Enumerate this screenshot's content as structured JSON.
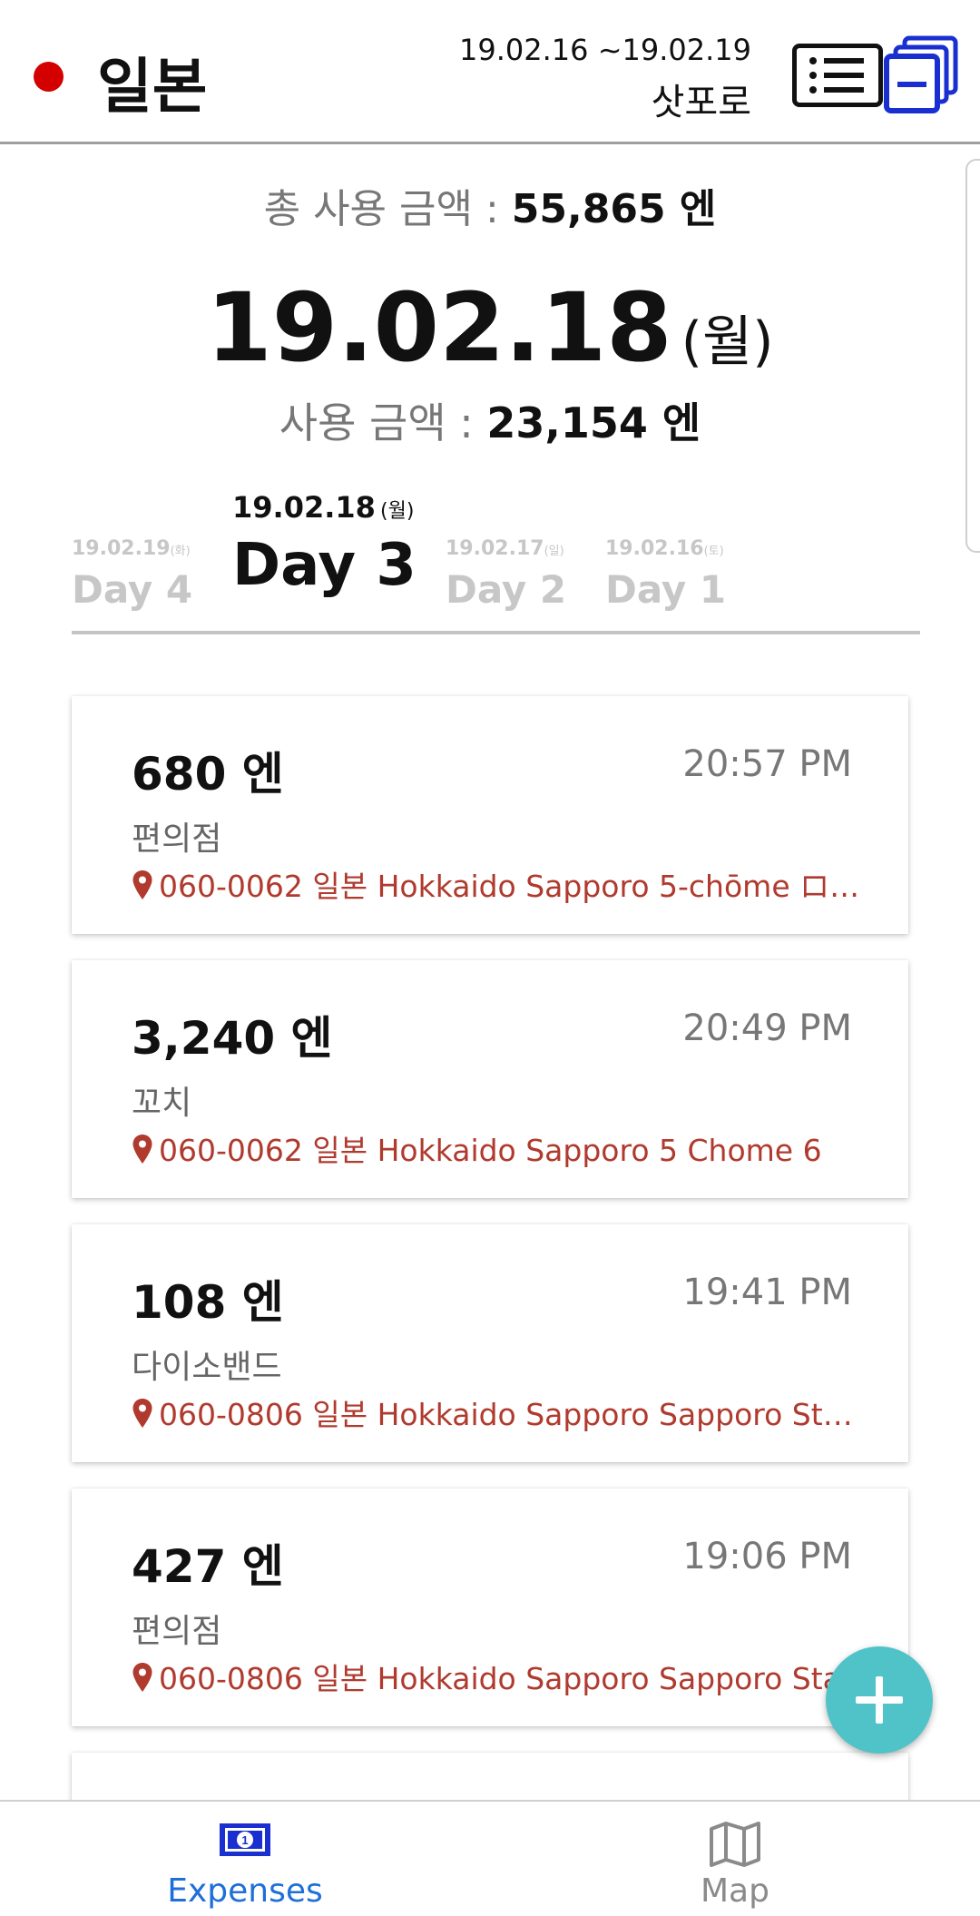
{
  "header": {
    "country": "일본",
    "trip_dates": "19.02.16 ~19.02.19",
    "city": "삿포로",
    "flag_color": "#d40000"
  },
  "summary": {
    "total_label": "총 사용 금액 :",
    "total_value": "55,865 엔",
    "date": "19.02.18",
    "weekday": "(월)",
    "day_label": "사용 금액 :",
    "day_value": "23,154 엔"
  },
  "tabs": [
    {
      "date": "19.02.19",
      "wd": "(화)",
      "label": "Day 4"
    },
    {
      "date": "19.02.18",
      "wd": "(월)",
      "label": "Day 3"
    },
    {
      "date": "19.02.17",
      "wd": "(일)",
      "label": "Day 2"
    },
    {
      "date": "19.02.16",
      "wd": "(토)",
      "label": "Day 1"
    }
  ],
  "expenses": [
    {
      "amount": "680 엔",
      "time": "20:57 PM",
      "category": "편의점",
      "address": "060-0062 일본 Hokkaido Sapporo 5-chōme ロジ…"
    },
    {
      "amount": "3,240 엔",
      "time": "20:49 PM",
      "category": "꼬치",
      "address": "060-0062 일본 Hokkaido Sapporo 5 Chome  6"
    },
    {
      "amount": "108 엔",
      "time": "19:41 PM",
      "category": "다이소밴드",
      "address": "060-0806 일본 Hokkaido Sapporo  Sapporo Stat…"
    },
    {
      "amount": "427 엔",
      "time": "19:06 PM",
      "category": "편의점",
      "address": "060-0806 일본 Hokkaido Sapporo  Sapporo Stat"
    }
  ],
  "nav": {
    "expenses_label": "Expenses",
    "map_label": "Map",
    "active_color": "#1e6fd9",
    "inactive_color": "#8a8a8a"
  },
  "colors": {
    "accent_blue": "#1a2fd0",
    "fab": "#4fc3c8",
    "address_red": "#b03a2e"
  },
  "icons": {
    "fab": "plus-icon",
    "list": "list-icon",
    "layers": "layers-icon",
    "pin": "location-pin-icon",
    "money": "banknote-icon",
    "map": "map-icon"
  }
}
